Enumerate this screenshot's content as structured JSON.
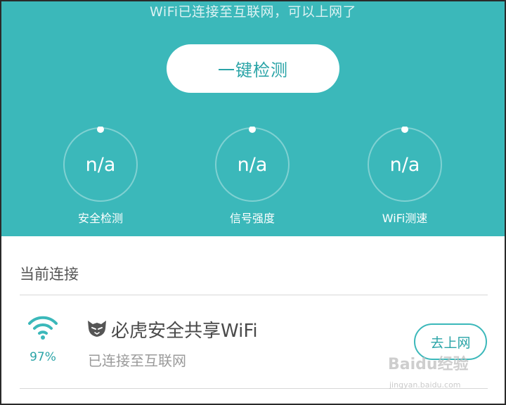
{
  "header": {
    "status_text": "WiFi已连接至互联网，可以上网了",
    "one_key_check_label": "一键检测"
  },
  "gauges": [
    {
      "value": "n/a",
      "label": "安全检测"
    },
    {
      "value": "n/a",
      "label": "信号强度"
    },
    {
      "value": "n/a",
      "label": "WiFi测速"
    }
  ],
  "current_connection": {
    "section_title": "当前连接",
    "signal_percent": "97%",
    "network_name": "必虎安全共享WiFi",
    "status": "已连接至互联网",
    "go_online_label": "去上网"
  },
  "watermark": {
    "brand": "Baidu经验",
    "url": "jingyan.baidu.com"
  },
  "colors": {
    "accent": "#3bb8ba",
    "accent_text": "#2aa4a7",
    "background": "#ffffff"
  },
  "icons": [
    "wifi-signal-icon",
    "tiger-logo-icon"
  ]
}
